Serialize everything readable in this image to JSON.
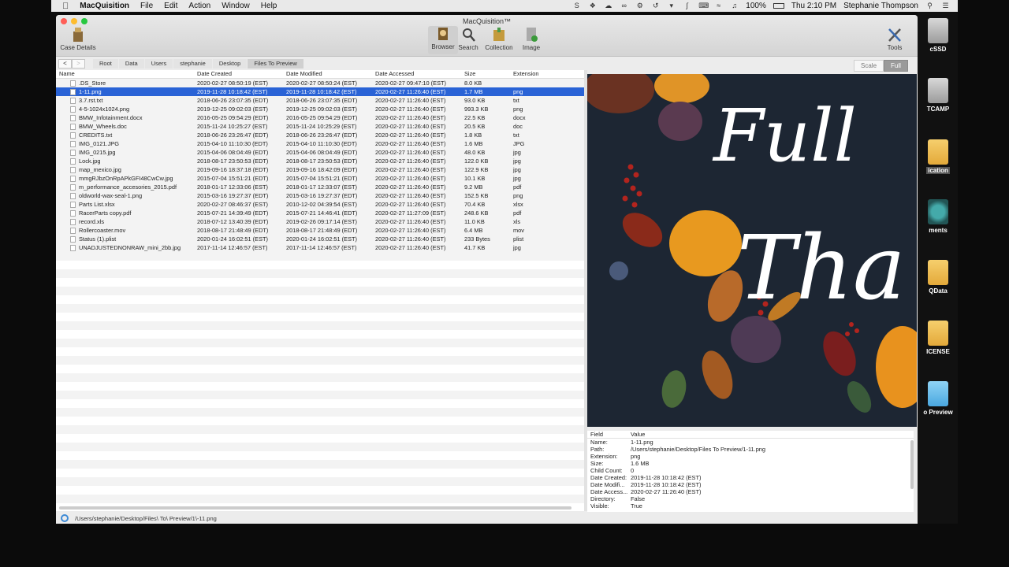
{
  "menubar": {
    "app": "MacQuisition",
    "items": [
      "File",
      "Edit",
      "Action",
      "Window",
      "Help"
    ],
    "battery": "100%",
    "clock": "Thu 2:10 PM",
    "user": "Stephanie Thompson"
  },
  "desktop": {
    "items": [
      {
        "label": "cSSD",
        "icon": "drive"
      },
      {
        "label": "TCAMP",
        "icon": "drive"
      },
      {
        "label": "ication",
        "icon": "folder"
      },
      {
        "label": "ments",
        "icon": "time-machine"
      },
      {
        "label": "QData",
        "icon": "folder"
      },
      {
        "label": "ICENSE",
        "icon": "folder"
      },
      {
        "label": "o Preview",
        "icon": "folder-blue"
      }
    ]
  },
  "window": {
    "title": "MacQuisition™",
    "toolbar": {
      "case_details": "Case Details",
      "browser": "Browser",
      "search": "Search",
      "collection": "Collection",
      "image": "Image",
      "tools": "Tools"
    },
    "nav": {
      "back": "<",
      "forward": ">"
    },
    "breadcrumb": [
      "Root",
      "Data",
      "Users",
      "stephanie",
      "Desktop",
      "Files To Preview"
    ],
    "viewmode": {
      "scale": "Scale",
      "full": "Full",
      "selected": "Full"
    },
    "columns": {
      "name": "Name",
      "date_created": "Date Created",
      "date_modified": "Date Modified",
      "date_accessed": "Date Accessed",
      "size": "Size",
      "extension": "Extension"
    },
    "files": [
      {
        "name": ".DS_Store",
        "dc": "2020-02-27 08:50:19 (EST)",
        "dm": "2020-02-27 08:50:24 (EST)",
        "da": "2020-02-27 09:47:10 (EST)",
        "size": "8.0 KB",
        "ext": ""
      },
      {
        "name": "1-11.png",
        "dc": "2019-11-28 10:18:42 (EST)",
        "dm": "2019-11-28 10:18:42 (EST)",
        "da": "2020-02-27 11:26:40 (EST)",
        "size": "1.7 MB",
        "ext": "png"
      },
      {
        "name": "3.7.rst.txt",
        "dc": "2018-06-26 23:07:35 (EDT)",
        "dm": "2018-06-26 23:07:35 (EDT)",
        "da": "2020-02-27 11:26:40 (EST)",
        "size": "93.0 KB",
        "ext": "txt"
      },
      {
        "name": "4-5-1024x1024.png",
        "dc": "2019-12-25 09:02:03 (EST)",
        "dm": "2019-12-25 09:02:03 (EST)",
        "da": "2020-02-27 11:26:40 (EST)",
        "size": "993.3 KB",
        "ext": "png"
      },
      {
        "name": "BMW_Infotainment.docx",
        "dc": "2016-05-25 09:54:29 (EDT)",
        "dm": "2016-05-25 09:54:29 (EDT)",
        "da": "2020-02-27 11:26:40 (EST)",
        "size": "22.5 KB",
        "ext": "docx"
      },
      {
        "name": "BMW_Wheels.doc",
        "dc": "2015-11-24 10:25:27 (EST)",
        "dm": "2015-11-24 10:25:29 (EST)",
        "da": "2020-02-27 11:26:40 (EST)",
        "size": "20.5 KB",
        "ext": "doc"
      },
      {
        "name": "CREDITS.txt",
        "dc": "2018-06-26 23:26:47 (EDT)",
        "dm": "2018-06-26 23:26:47 (EDT)",
        "da": "2020-02-27 11:26:40 (EST)",
        "size": "1.8 KB",
        "ext": "txt"
      },
      {
        "name": "IMG_0121.JPG",
        "dc": "2015-04-10 11:10:30 (EDT)",
        "dm": "2015-04-10 11:10:30 (EDT)",
        "da": "2020-02-27 11:26:40 (EST)",
        "size": "1.6 MB",
        "ext": "JPG"
      },
      {
        "name": "IMG_0215.jpg",
        "dc": "2015-04-06 08:04:49 (EDT)",
        "dm": "2015-04-06 08:04:49 (EDT)",
        "da": "2020-02-27 11:26:40 (EST)",
        "size": "48.0 KB",
        "ext": "jpg"
      },
      {
        "name": "Lock.jpg",
        "dc": "2018-08-17 23:50:53 (EDT)",
        "dm": "2018-08-17 23:50:53 (EDT)",
        "da": "2020-02-27 11:26:40 (EST)",
        "size": "122.0 KB",
        "ext": "jpg"
      },
      {
        "name": "map_mexico.jpg",
        "dc": "2019-09-16 18:37:18 (EDT)",
        "dm": "2019-09-16 18:42:09 (EDT)",
        "da": "2020-02-27 11:26:40 (EST)",
        "size": "122.9 KB",
        "ext": "jpg"
      },
      {
        "name": "mmgRJbzOnRpAPkGFI48CwCw.jpg",
        "dc": "2015-07-04 15:51:21 (EDT)",
        "dm": "2015-07-04 15:51:21 (EDT)",
        "da": "2020-02-27 11:26:40 (EST)",
        "size": "10.1 KB",
        "ext": "jpg"
      },
      {
        "name": "m_performance_accesories_2015.pdf",
        "dc": "2018-01-17 12:33:06 (EST)",
        "dm": "2018-01-17 12:33:07 (EST)",
        "da": "2020-02-27 11:26:40 (EST)",
        "size": "9.2 MB",
        "ext": "pdf"
      },
      {
        "name": "oldworld-wax-seal-1.png",
        "dc": "2015-03-16 19:27:37 (EDT)",
        "dm": "2015-03-16 19:27:37 (EDT)",
        "da": "2020-02-27 11:26:40 (EST)",
        "size": "152.5 KB",
        "ext": "png"
      },
      {
        "name": "Parts List.xlsx",
        "dc": "2020-02-27 08:46:37 (EST)",
        "dm": "2010-12-02 04:39:54 (EST)",
        "da": "2020-02-27 11:26:40 (EST)",
        "size": "70.4 KB",
        "ext": "xlsx"
      },
      {
        "name": "RacerParts copy.pdf",
        "dc": "2015-07-21 14:39:49 (EDT)",
        "dm": "2015-07-21 14:46:41 (EDT)",
        "da": "2020-02-27 11:27:09 (EST)",
        "size": "248.6 KB",
        "ext": "pdf"
      },
      {
        "name": "record.xls",
        "dc": "2018-07-12 13:40:39 (EDT)",
        "dm": "2019-02-26 09:17:14 (EST)",
        "da": "2020-02-27 11:26:40 (EST)",
        "size": "11.0 KB",
        "ext": "xls"
      },
      {
        "name": "Rollercoaster.mov",
        "dc": "2018-08-17 21:48:49 (EDT)",
        "dm": "2018-08-17 21:48:49 (EDT)",
        "da": "2020-02-27 11:26:40 (EST)",
        "size": "6.4 MB",
        "ext": "mov"
      },
      {
        "name": "Status (1).plist",
        "dc": "2020-01-24 16:02:51 (EST)",
        "dm": "2020-01-24 16:02:51 (EST)",
        "da": "2020-02-27 11:26:40 (EST)",
        "size": "233 Bytes",
        "ext": "plist"
      },
      {
        "name": "UNADJUSTEDNONRAW_mini_2bb.jpg",
        "dc": "2017-11-14 12:46:57 (EST)",
        "dm": "2017-11-14 12:46:57 (EST)",
        "da": "2020-02-27 11:26:40 (EST)",
        "size": "41.7 KB",
        "ext": "jpg"
      }
    ],
    "selected_index": 1,
    "preview": {
      "text_line1": "Full",
      "text_line2": "Tha"
    },
    "info": {
      "header_field": "Field",
      "header_value": "Value",
      "rows": [
        {
          "k": "Name:",
          "v": "1-11.png"
        },
        {
          "k": "Path:",
          "v": "/Users/stephanie/Desktop/Files To Preview/1-11.png"
        },
        {
          "k": "Extension:",
          "v": "png"
        },
        {
          "k": "Size:",
          "v": "1.6 MB"
        },
        {
          "k": "Child Count:",
          "v": "0"
        },
        {
          "k": "Date Created:",
          "v": "2019-11-28 10:18:42 (EST)"
        },
        {
          "k": "Date Modifi...",
          "v": "2019-11-28 10:18:42 (EST)"
        },
        {
          "k": "Date Access...",
          "v": "2020-02-27 11:26:40 (EST)"
        },
        {
          "k": "Directory:",
          "v": "False"
        },
        {
          "k": "Visible:",
          "v": "True"
        }
      ]
    },
    "status_path": "/Users/stephanie/Desktop/Files\\ To\\ Preview/1\\-11.png"
  }
}
